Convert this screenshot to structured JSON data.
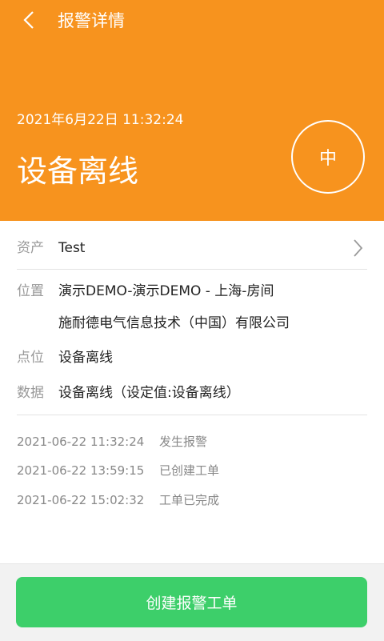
{
  "header": {
    "title": "报警详情",
    "alarm_time": "2021年6月22日 11:32:24",
    "alarm_title": "设备离线",
    "level": "中",
    "color": "#f7931e"
  },
  "details": {
    "asset_label": "资产",
    "asset_value": "Test",
    "location_label": "位置",
    "location_line1": "演示DEMO-演示DEMO - 上海-房间",
    "location_line2": "施耐德电气信息技术（中国）有限公司",
    "point_label": "点位",
    "point_value": "设备离线",
    "data_label": "数据",
    "data_value": "设备离线（设定值:设备离线）"
  },
  "log": [
    {
      "time": "2021-06-22  11:32:24",
      "event": "发生报警"
    },
    {
      "time": "2021-06-22  13:59:15",
      "event": "已创建工单"
    },
    {
      "time": "2021-06-22  15:02:32",
      "event": "工单已完成"
    }
  ],
  "actions": {
    "create_label": "创建报警工单",
    "color": "#3dcf6a"
  },
  "icons": [
    "back-arrow-icon",
    "chevron-right-icon"
  ]
}
